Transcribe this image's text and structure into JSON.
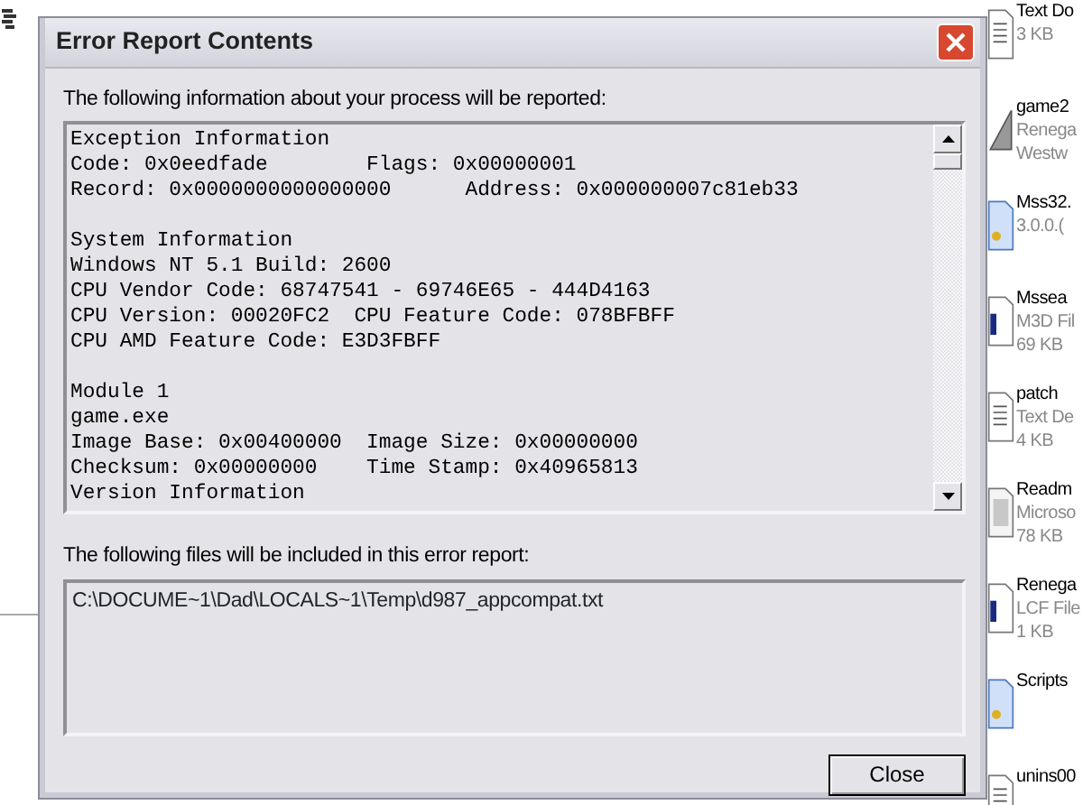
{
  "window": {
    "title": "Error Report Contents"
  },
  "report_label": "The following information about your process will be reported:",
  "report_sections": [
    [
      "Exception Information",
      "Code: 0x0eedfade        Flags: 0x00000001",
      "Record: 0x0000000000000000      Address: 0x000000007c81eb33"
    ],
    [
      "System Information",
      "Windows NT 5.1 Build: 2600",
      "CPU Vendor Code: 68747541 - 69746E65 - 444D4163",
      "CPU Version: 00020FC2  CPU Feature Code: 078BFBFF",
      "CPU AMD Feature Code: E3D3FBFF"
    ],
    [
      "Module 1",
      "game.exe",
      "Image Base: 0x00400000  Image Size: 0x00000000",
      "Checksum: 0x00000000    Time Stamp: 0x40965813",
      "Version Information"
    ]
  ],
  "files_label": "The following files will be included in this error report:",
  "files": [
    "C:\\DOCUME~1\\Dad\\LOCALS~1\\Temp\\d987_appcompat.txt"
  ],
  "close_button": "Close",
  "desktop_files": [
    {
      "kind": "text",
      "lines": [
        "Text Do",
        "3 KB"
      ]
    },
    {
      "kind": "shortcut",
      "lines": [
        "game2",
        "Renega",
        "Westw"
      ]
    },
    {
      "kind": "dll",
      "lines": [
        "Mss32.",
        "3.0.0.("
      ]
    },
    {
      "kind": "blank",
      "lines": [
        "Mssea",
        "M3D Fil",
        "69 KB"
      ]
    },
    {
      "kind": "text",
      "lines": [
        "patch",
        "Text De",
        "4 KB"
      ]
    },
    {
      "kind": "doc",
      "lines": [
        "Readm",
        "Microso",
        "78 KB"
      ]
    },
    {
      "kind": "blank",
      "lines": [
        "Renega",
        "LCF File",
        "1 KB"
      ]
    },
    {
      "kind": "dll",
      "lines": [
        "Scripts"
      ]
    },
    {
      "kind": "text",
      "lines": [
        "unins00"
      ]
    }
  ]
}
